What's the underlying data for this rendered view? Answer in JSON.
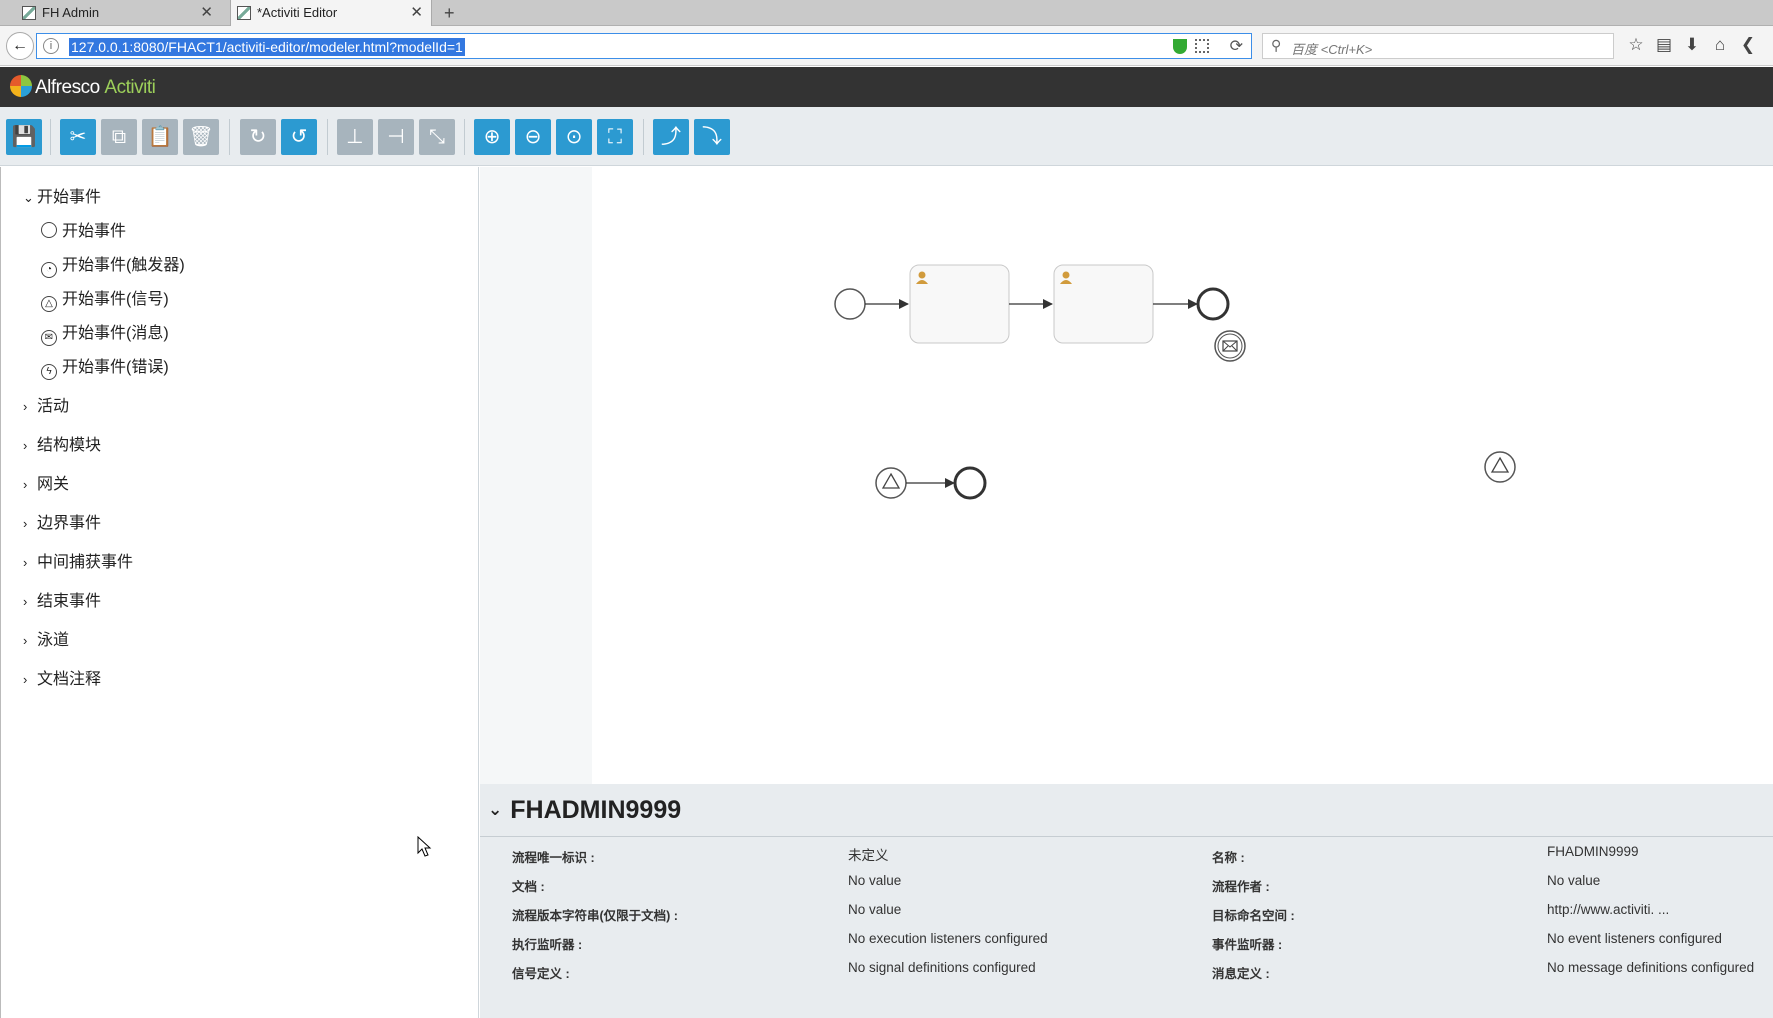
{
  "browser": {
    "tabs": [
      {
        "label": "FH Admin",
        "active": false
      },
      {
        "label": "*Activiti Editor",
        "active": true
      }
    ],
    "new_tab": "+",
    "url": "127.0.0.1:8080/FHACT1/activiti-editor/modeler.html?modelId=1",
    "search_placeholder": "百度 <Ctrl+K>"
  },
  "app": {
    "brand": "Alfresco",
    "brand_product": "Activiti"
  },
  "toolbar": {
    "buttons": [
      "save",
      "cut",
      "copy",
      "paste",
      "delete",
      "redo",
      "undo",
      "align-vertical",
      "align-horizontal",
      "same-size",
      "zoom-in",
      "zoom-out",
      "zoom-actual",
      "zoom-fit",
      "bendpoint-add",
      "bendpoint-remove"
    ],
    "accent_color": "#2c9ad1",
    "disabled_color": "#a7b4bd"
  },
  "palette": {
    "start_group": "开始事件",
    "start_items": [
      "开始事件",
      "开始事件(触发器)",
      "开始事件(信号)",
      "开始事件(消息)",
      "开始事件(错误)"
    ],
    "groups": [
      "活动",
      "结构模块",
      "网关",
      "边界事件",
      "中间捕获事件",
      "结束事件",
      "泳道",
      "文档注释"
    ]
  },
  "properties": {
    "title": "FHADMIN9999",
    "left": [
      {
        "label": "流程唯一标识 :",
        "value": "未定义"
      },
      {
        "label": "文档 :",
        "value": "No value"
      },
      {
        "label": "流程版本字符串(仅限于文档) :",
        "value": "No value"
      },
      {
        "label": "执行监听器 :",
        "value": "No execution listeners configured"
      },
      {
        "label": "信号定义 :",
        "value": "No signal definitions configured"
      }
    ],
    "right": [
      {
        "label": "名称 :",
        "value": "FHADMIN9999"
      },
      {
        "label": "流程作者 :",
        "value": "No value"
      },
      {
        "label": "目标命名空间 :",
        "value": "http://www.activiti. ..."
      },
      {
        "label": "事件监听器 :",
        "value": "No event listeners configured"
      },
      {
        "label": "消息定义 :",
        "value": "No message definitions configured"
      }
    ]
  }
}
